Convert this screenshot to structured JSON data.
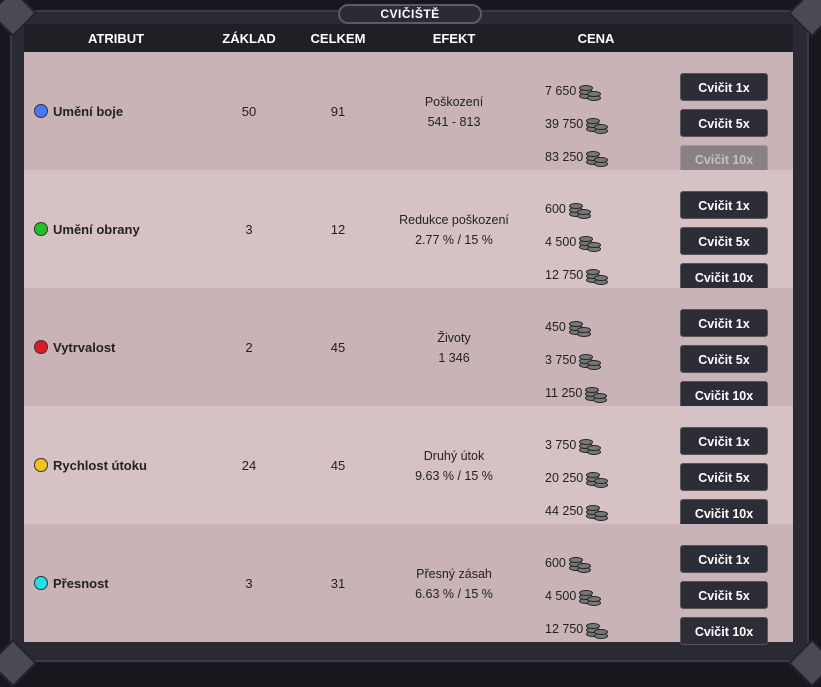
{
  "title": "CVIČIŠTĚ",
  "headers": {
    "attribute": "ATRIBUT",
    "base": "ZÁKLAD",
    "total": "CELKEM",
    "effect": "EFEKT",
    "price": "CENA"
  },
  "rows": [
    {
      "name": "Umění boje",
      "dot_color": "#4a77f0",
      "base": "50",
      "total": "91",
      "effect_label": "Poškození",
      "effect_value": "541 - 813",
      "prices": [
        "7 650",
        "39 750",
        "83 250"
      ],
      "buttons": [
        "Cvičit 1x",
        "Cvičit 5x",
        "Cvičit 10x"
      ],
      "disabled": [
        false,
        false,
        true
      ]
    },
    {
      "name": "Umění obrany",
      "dot_color": "#22c02a",
      "base": "3",
      "total": "12",
      "effect_label": "Redukce poškození",
      "effect_value": "2.77 % / 15 %",
      "prices": [
        "600",
        "4 500",
        "12 750"
      ],
      "buttons": [
        "Cvičit 1x",
        "Cvičit 5x",
        "Cvičit 10x"
      ],
      "disabled": [
        false,
        false,
        false
      ]
    },
    {
      "name": "Vytrvalost",
      "dot_color": "#e01a25",
      "base": "2",
      "total": "45",
      "effect_label": "Životy",
      "effect_value": "1 346",
      "prices": [
        "450",
        "3 750",
        "11 250"
      ],
      "buttons": [
        "Cvičit 1x",
        "Cvičit 5x",
        "Cvičit 10x"
      ],
      "disabled": [
        false,
        false,
        false
      ]
    },
    {
      "name": "Rychlost útoku",
      "dot_color": "#f0c419",
      "base": "24",
      "total": "45",
      "effect_label": "Druhý útok",
      "effect_value": "9.63 % / 15 %",
      "prices": [
        "3 750",
        "20 250",
        "44 250"
      ],
      "buttons": [
        "Cvičit 1x",
        "Cvičit 5x",
        "Cvičit 10x"
      ],
      "disabled": [
        false,
        false,
        false
      ]
    },
    {
      "name": "Přesnost",
      "dot_color": "#1fe0e6",
      "base": "3",
      "total": "31",
      "effect_label": "Přesný zásah",
      "effect_value": "6.63 % / 15 %",
      "prices": [
        "600",
        "4 500",
        "12 750"
      ],
      "buttons": [
        "Cvičit 1x",
        "Cvičit 5x",
        "Cvičit 10x"
      ],
      "disabled": [
        false,
        false,
        false
      ]
    }
  ]
}
